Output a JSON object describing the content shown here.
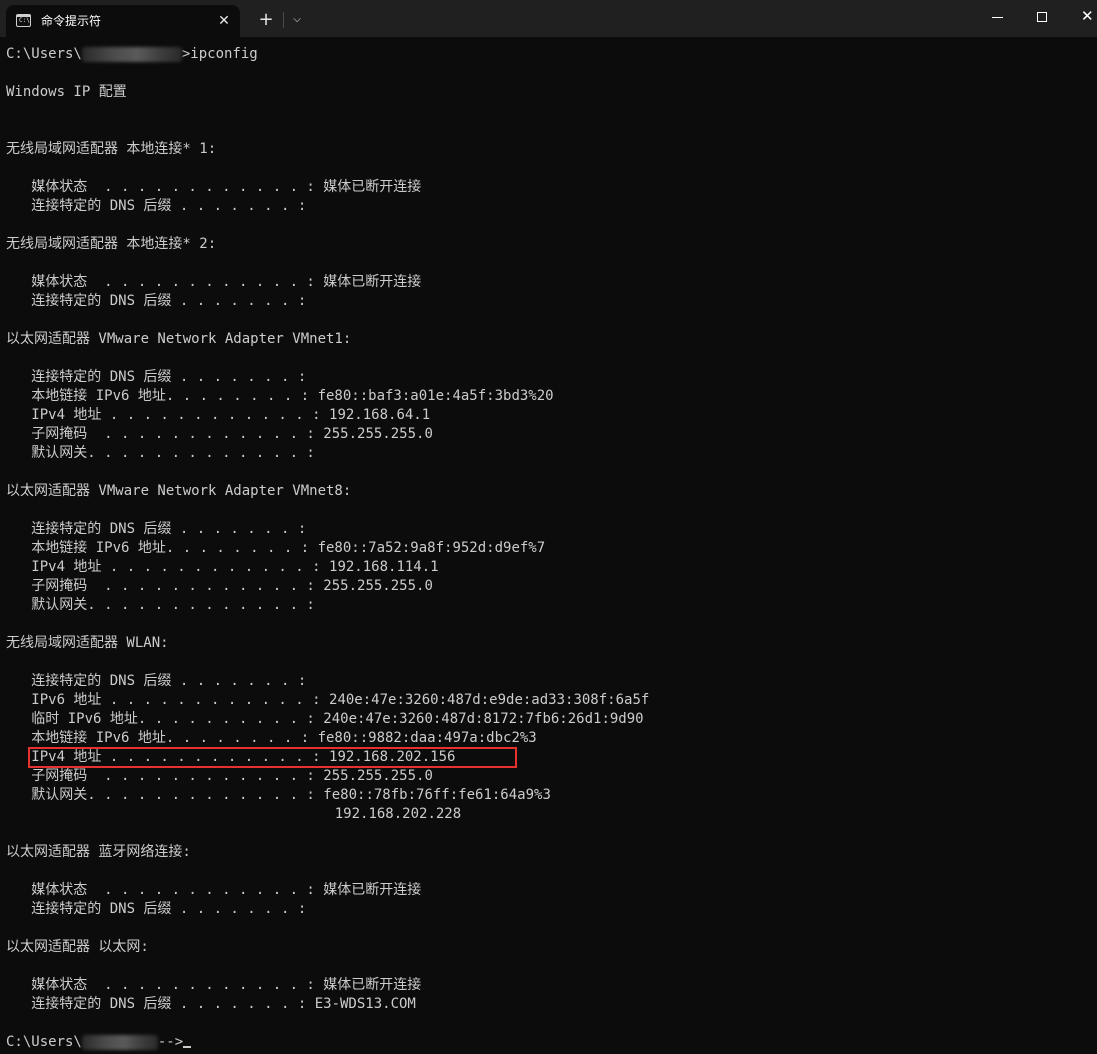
{
  "window": {
    "tab_title": "命令提示符",
    "tab_icon_glyph": "C:\\",
    "tab_close_glyph": "✕",
    "new_tab_glyph": "+",
    "dropdown_glyph": "⌵",
    "close_glyph": "✕",
    "icons": {
      "tab": "command-prompt-icon",
      "close": "close-icon",
      "new_tab": "plus-icon",
      "dropdown": "chevron-down-icon",
      "minimize": "minimize-icon",
      "maximize": "maximize-icon"
    }
  },
  "console": {
    "prompt_start": "C:\\Users\\",
    "command": ">ipconfig",
    "title": "Windows IP 配置",
    "prompt_end_prefix": "C:\\Users\\",
    "prompt_end_suffix": "-->",
    "sections": [
      {
        "header": "无线局域网适配器 本地连接* 1:",
        "rows": [
          {
            "label": "   媒体状态  . . . . . . . . . . . . : ",
            "value": "媒体已断开连接"
          },
          {
            "label": "   连接特定的 DNS 后缀 . . . . . . . : ",
            "value": ""
          }
        ]
      },
      {
        "header": "无线局域网适配器 本地连接* 2:",
        "rows": [
          {
            "label": "   媒体状态  . . . . . . . . . . . . : ",
            "value": "媒体已断开连接"
          },
          {
            "label": "   连接特定的 DNS 后缀 . . . . . . . : ",
            "value": ""
          }
        ]
      },
      {
        "header": "以太网适配器 VMware Network Adapter VMnet1:",
        "rows": [
          {
            "label": "   连接特定的 DNS 后缀 . . . . . . . : ",
            "value": ""
          },
          {
            "label": "   本地链接 IPv6 地址. . . . . . . . : ",
            "value": "fe80::baf3:a01e:4a5f:3bd3%20"
          },
          {
            "label": "   IPv4 地址 . . . . . . . . . . . . : ",
            "value": "192.168.64.1"
          },
          {
            "label": "   子网掩码  . . . . . . . . . . . . : ",
            "value": "255.255.255.0"
          },
          {
            "label": "   默认网关. . . . . . . . . . . . . : ",
            "value": ""
          }
        ]
      },
      {
        "header": "以太网适配器 VMware Network Adapter VMnet8:",
        "rows": [
          {
            "label": "   连接特定的 DNS 后缀 . . . . . . . : ",
            "value": ""
          },
          {
            "label": "   本地链接 IPv6 地址. . . . . . . . : ",
            "value": "fe80::7a52:9a8f:952d:d9ef%7"
          },
          {
            "label": "   IPv4 地址 . . . . . . . . . . . . : ",
            "value": "192.168.114.1"
          },
          {
            "label": "   子网掩码  . . . . . . . . . . . . : ",
            "value": "255.255.255.0"
          },
          {
            "label": "   默认网关. . . . . . . . . . . . . : ",
            "value": ""
          }
        ]
      },
      {
        "header": "无线局域网适配器 WLAN:",
        "rows": [
          {
            "label": "   连接特定的 DNS 后缀 . . . . . . . : ",
            "value": ""
          },
          {
            "label": "   IPv6 地址 . . . . . . . . . . . . : ",
            "value": "240e:47e:3260:487d:e9de:ad33:308f:6a5f"
          },
          {
            "label": "   临时 IPv6 地址. . . . . . . . . . : ",
            "value": "240e:47e:3260:487d:8172:7fb6:26d1:9d90"
          },
          {
            "label": "   本地链接 IPv6 地址. . . . . . . . : ",
            "value": "fe80::9882:daa:497a:dbc2%3"
          },
          {
            "label": "   IPv4 地址 . . . . . . . . . . . . : ",
            "value": "192.168.202.156"
          },
          {
            "label": "   子网掩码  . . . . . . . . . . . . : ",
            "value": "255.255.255.0"
          },
          {
            "label": "   默认网关. . . . . . . . . . . . . : ",
            "value": "fe80::78fb:76ff:fe61:64a9%3"
          },
          {
            "label": "                                       ",
            "value": "192.168.202.228"
          }
        ]
      },
      {
        "header": "以太网适配器 蓝牙网络连接:",
        "rows": [
          {
            "label": "   媒体状态  . . . . . . . . . . . . : ",
            "value": "媒体已断开连接"
          },
          {
            "label": "   连接特定的 DNS 后缀 . . . . . . . : ",
            "value": ""
          }
        ]
      },
      {
        "header": "以太网适配器 以太网:",
        "rows": [
          {
            "label": "   媒体状态  . . . . . . . . . . . . : ",
            "value": "媒体已断开连接"
          },
          {
            "label": "   连接特定的 DNS 后缀 . . . . . . . : ",
            "value": "E3-WDS13.COM"
          }
        ]
      }
    ]
  },
  "colors": {
    "background": "#0c0c0c",
    "titlebar": "#202020",
    "text": "#cccccc",
    "highlight": "#e5322d"
  }
}
